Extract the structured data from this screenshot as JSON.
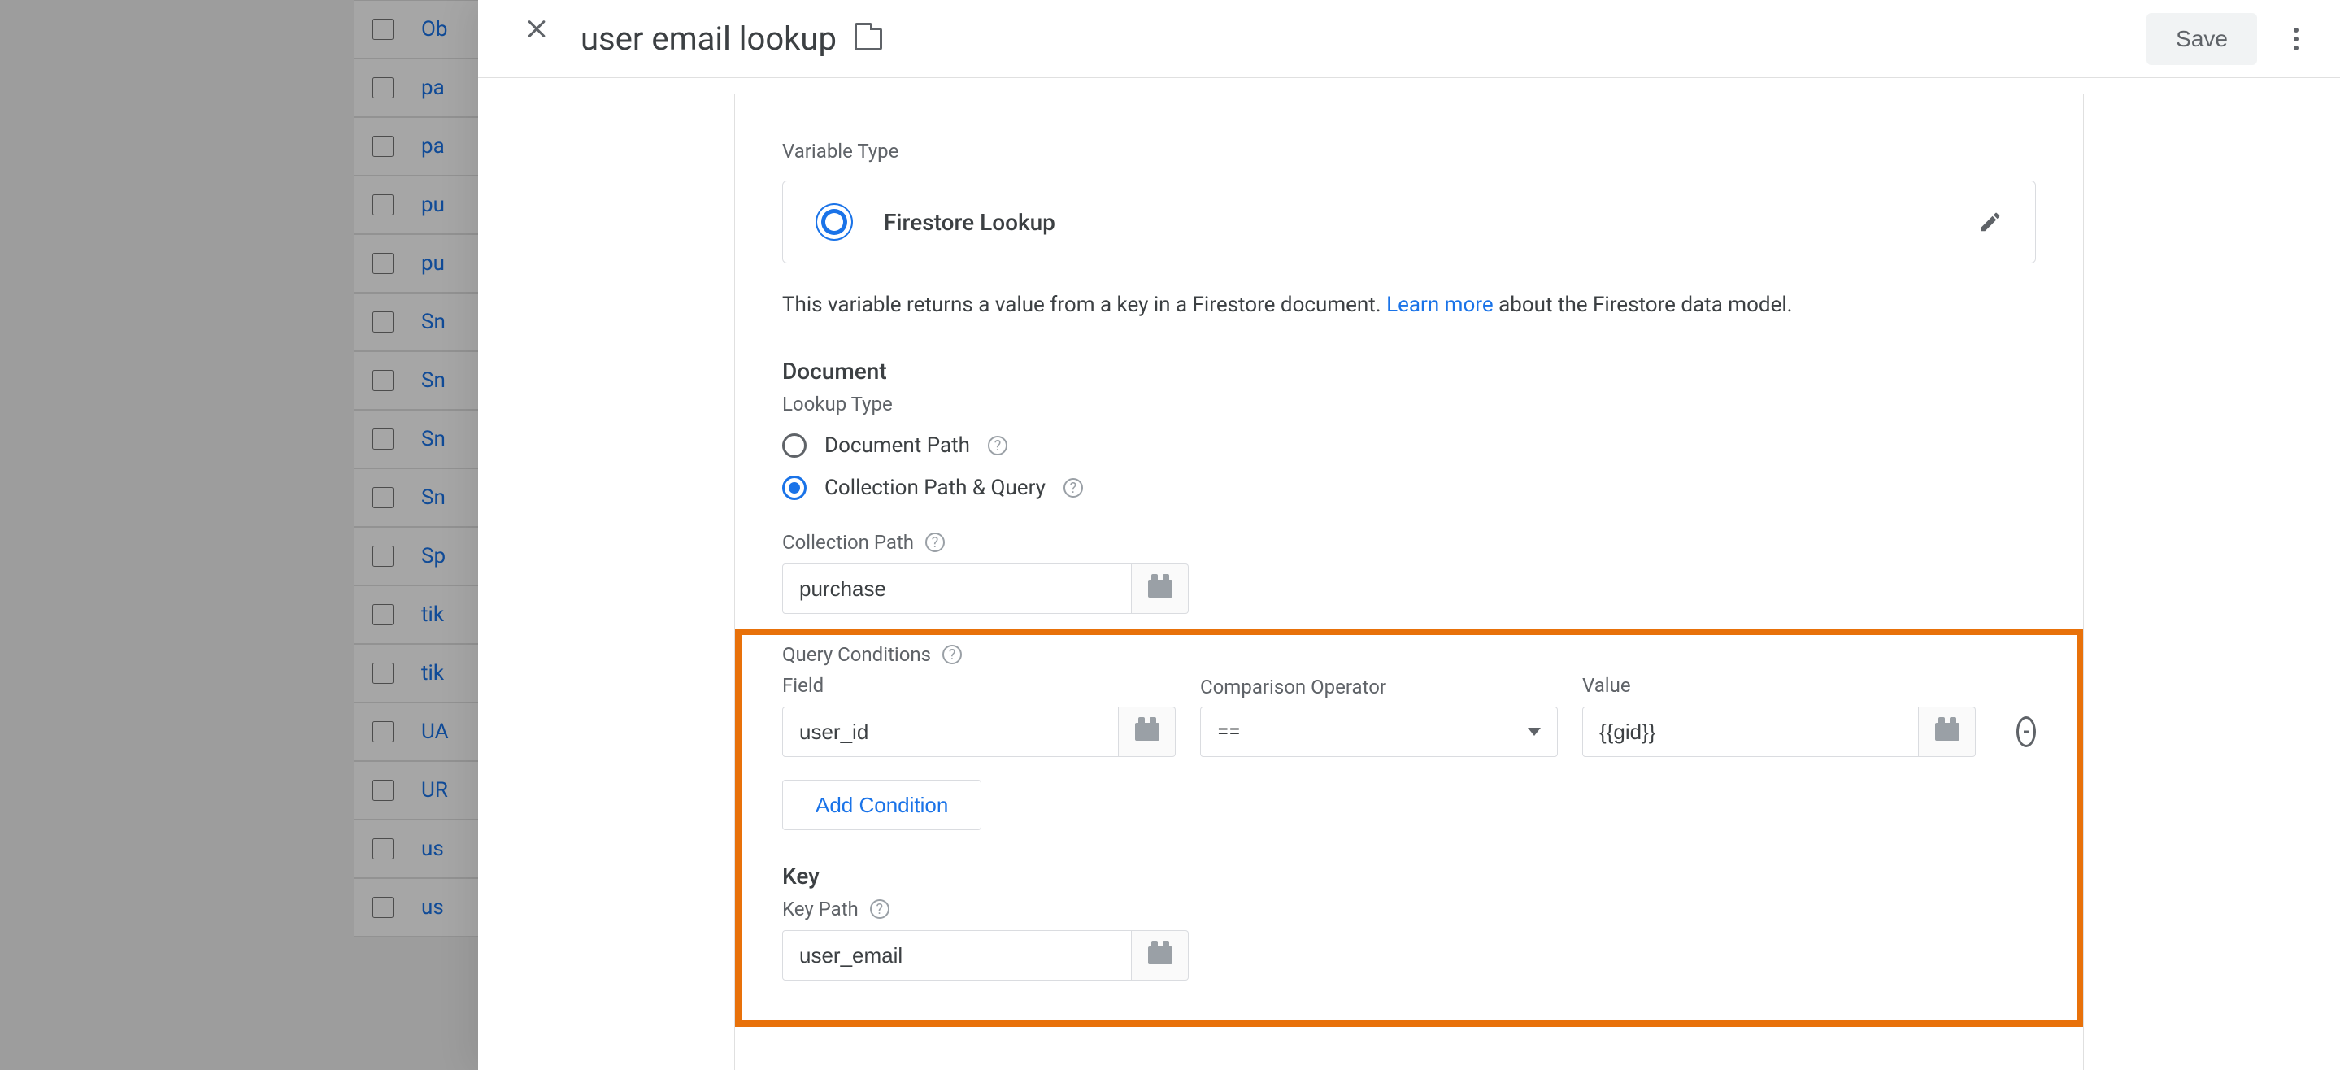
{
  "panel": {
    "title": "user email lookup",
    "save_label": "Save"
  },
  "variable_type": {
    "label": "Variable Type",
    "name": "Firestore Lookup",
    "description_pre": "This variable returns a value from a key in a Firestore document. ",
    "learn_more": "Learn more",
    "description_post": " about the Firestore data model."
  },
  "document": {
    "section_title": "Document",
    "lookup_type_label": "Lookup Type",
    "radio_doc_path": "Document Path",
    "radio_collection_query": "Collection Path & Query",
    "selected_lookup_type": "collection",
    "collection_path_label": "Collection Path",
    "collection_path_value": "purchase"
  },
  "conditions": {
    "section_label": "Query Conditions",
    "col_field": "Field",
    "col_operator": "Comparison Operator",
    "col_value": "Value",
    "rows": [
      {
        "field": "user_id",
        "operator": "==",
        "value": "{{gid}}"
      }
    ],
    "add_label": "Add Condition"
  },
  "key": {
    "section_title": "Key",
    "key_path_label": "Key Path",
    "key_path_value": "user_email"
  },
  "bg_rows": [
    "Ob",
    "pa",
    "pa",
    "pu",
    "pu",
    "Sn",
    "Sn",
    "Sn",
    "Sn",
    "Sp",
    "tik",
    "tik",
    "UA",
    "UR",
    "us",
    "us"
  ]
}
